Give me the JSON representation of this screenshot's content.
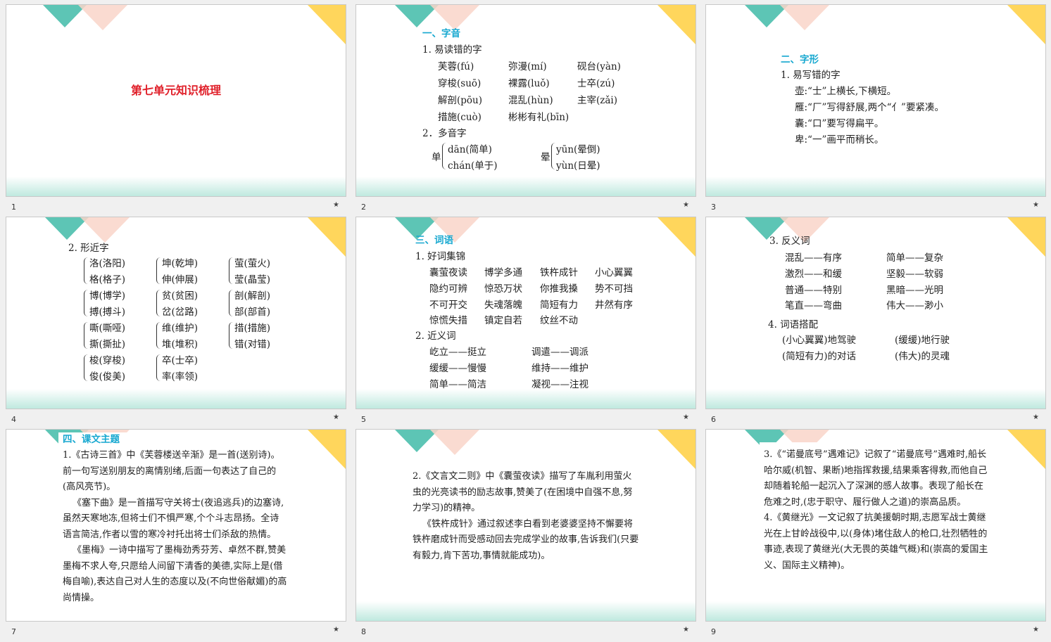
{
  "colors": {
    "teal": "#5dc5b5",
    "pink": "#f9d5c9",
    "yellow": "#ffd65c",
    "heading": "#17a8d0",
    "title": "#e0202a"
  },
  "slides": [
    {
      "num": "1",
      "title": "第七单元知识梳理"
    },
    {
      "num": "2",
      "heading": "一、字音",
      "sub1": "1. 易读错的字",
      "words": [
        [
          "芙蓉(fú)",
          "弥漫(mí)",
          "砚台(yàn)"
        ],
        [
          "穿梭(suō)",
          "裸露(luǒ)",
          "士卒(zú)"
        ],
        [
          "解剖(pōu)",
          "混乱(hùn)",
          "主宰(zǎi)"
        ],
        [
          "措施(cuò)",
          "彬彬有礼(bīn)",
          ""
        ]
      ],
      "sub2": "2．多音字",
      "poly1": {
        "char": "单",
        "a": "dān(简单)",
        "b": "chán(单于)"
      },
      "poly2": {
        "char": "晕",
        "a": "yūn(晕倒)",
        "b": "yùn(日晕)"
      }
    },
    {
      "num": "3",
      "heading": "二、字形",
      "sub1": "1. 易写错的字",
      "lines": [
        "壶:“士”上横长,下横短。",
        "雁:“厂”写得舒展,两个“亻”要紧凑。",
        "囊:“口”要写得扁平。",
        "卑:“一”画平而稍长。"
      ]
    },
    {
      "num": "4",
      "sub": "2. 形近字",
      "groups": [
        [
          "洛(洛阳)",
          "格(格子)"
        ],
        [
          "坤(乾坤)",
          "伸(伸展)"
        ],
        [
          "萤(萤火)",
          "莹(晶莹)"
        ],
        [
          "博(博学)",
          "搏(搏斗)"
        ],
        [
          "贫(贫困)",
          "岔(岔路)"
        ],
        [
          "剖(解剖)",
          "部(部首)"
        ],
        [
          "嘶(嘶哑)",
          "撕(撕扯)"
        ],
        [
          "维(维护)",
          "堆(堆积)"
        ],
        [
          "措(措施)",
          "错(对错)"
        ],
        [
          "梭(穿梭)",
          "俊(俊美)"
        ],
        [
          "卒(士卒)",
          "率(率领)"
        ]
      ]
    },
    {
      "num": "5",
      "heading": "三、词语",
      "sub1": "1. 好词集锦",
      "good": [
        [
          "囊萤夜读",
          "博学多通",
          "铁杵成针",
          "小心翼翼"
        ],
        [
          "隐约可辨",
          "惊恐万状",
          "你推我搡",
          "势不可挡"
        ],
        [
          "不可开交",
          "失魂落魄",
          "简短有力",
          "井然有序"
        ],
        [
          "惊慌失措",
          "镇定自若",
          "纹丝不动",
          ""
        ]
      ],
      "sub2": "2. 近义词",
      "syn": [
        [
          "屹立——挺立",
          "调遣——调派"
        ],
        [
          "缓缓——慢慢",
          "维持——维护"
        ],
        [
          "简单——简洁",
          "凝视——注视"
        ]
      ]
    },
    {
      "num": "6",
      "sub1": "3. 反义词",
      "ant": [
        [
          "混乱——有序",
          "简单——复杂"
        ],
        [
          "激烈——和缓",
          "坚毅——软弱"
        ],
        [
          "普通——特别",
          "黑暗——光明"
        ],
        [
          "笔直——弯曲",
          "伟大——渺小"
        ]
      ],
      "sub2": "4. 词语搭配",
      "col": [
        [
          "(小心翼翼)地驾驶",
          "(缓缓)地行驶"
        ],
        [
          "(简短有力)的对话",
          "(伟大)的灵魂"
        ]
      ]
    },
    {
      "num": "7",
      "heading": "四、课文主题",
      "paras": [
        "1.《古诗三首》中《芙蓉楼送辛渐》是一首(送别诗)。前一句写送别朋友的离情别绪,后面一句表达了自己的(高风亮节)。",
        "《塞下曲》是一首描写守关将士(夜追逃兵)的边塞诗,虽然天寒地冻,但将士们不惧严寒,个个斗志昂扬。全诗语言简洁,作者以雪的寒冷衬托出将士们杀敌的热情。",
        "《墨梅》一诗中描写了墨梅劲秀芬芳、卓然不群,赞美墨梅不求人夸,只愿给人间留下清香的美德,实际上是(借梅自喻),表达自己对人生的态度以及(不向世俗献媚)的高尚情操。"
      ]
    },
    {
      "num": "8",
      "paras": [
        "2.《文言文二则》中《囊萤夜读》描写了车胤利用萤火虫的光亮读书的励志故事,赞美了(在困境中自强不息,努力学习)的精神。",
        "《铁杵成针》通过叙述李白看到老婆婆坚持不懈要将铁杵磨成针而受感动回去完成学业的故事,告诉我们(只要有毅力,肯下苦功,事情就能成功)。"
      ]
    },
    {
      "num": "9",
      "paras": [
        "3.《“诺曼底号”遇难记》记叙了“诺曼底号”遇难时,船长哈尔威(机智、果断)地指挥救援,结果乘客得救,而他自己却随着轮船一起沉入了深渊的感人故事。表现了船长在危难之时,(忠于职守、履行做人之道)的崇高品质。",
        "4.《黄继光》一文记叙了抗美援朝时期,志愿军战士黄继光在上甘岭战役中,以(身体)堵住敌人的枪口,壮烈牺牲的事迹,表现了黄继光(大无畏的英雄气概)和(崇高的爱国主义、国际主义精神)。"
      ]
    }
  ],
  "star": "★"
}
